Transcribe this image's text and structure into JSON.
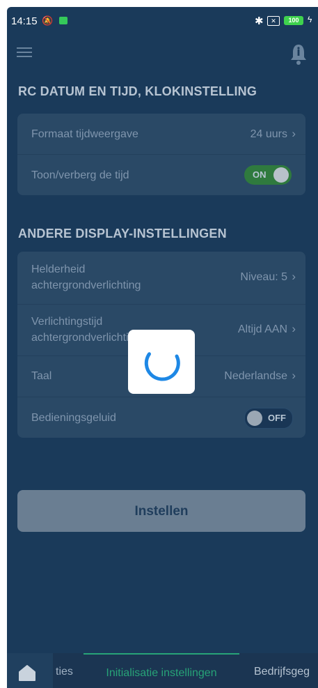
{
  "status_bar": {
    "time": "14:15",
    "battery": "100",
    "icons": [
      "mute-icon",
      "app-notification-icon",
      "bluetooth-icon",
      "signal-icon",
      "battery-icon",
      "charging-icon"
    ]
  },
  "header": {
    "menu_icon": "hamburger-icon",
    "notification_icon": "bell-icon"
  },
  "section1": {
    "title": "RC DATUM EN TIJD, KLOKINSTELLING",
    "rows": [
      {
        "label": "Formaat tijdweergave",
        "value": "24 uurs"
      },
      {
        "label": "Toon/verberg de tijd",
        "toggle": "ON",
        "toggle_state": true
      }
    ]
  },
  "section2": {
    "title": "ANDERE DISPLAY-INSTELLINGEN",
    "rows": [
      {
        "label_line1": "Helderheid",
        "label_line2": "achtergrondverlichting",
        "value": "Niveau: 5"
      },
      {
        "label_line1": "Verlichtingstijd",
        "label_line2": "achtergrondverlichting",
        "value": "Altijd AAN"
      },
      {
        "label": "Taal",
        "value": "Nederlandse"
      },
      {
        "label": "Bedieningsgeluid",
        "toggle": "OFF",
        "toggle_state": false
      }
    ]
  },
  "apply_button": "Instellen",
  "loading_overlay": {
    "icon": "spinner-icon",
    "color": "#1e88e5"
  },
  "bottom_nav": {
    "home_icon": "home-icon",
    "tabs": [
      "ties",
      "Initialisatie instellingen",
      "Bedrijfsgeg"
    ],
    "active_tab": 1,
    "active_color": "#27a377"
  },
  "chevron": "›"
}
